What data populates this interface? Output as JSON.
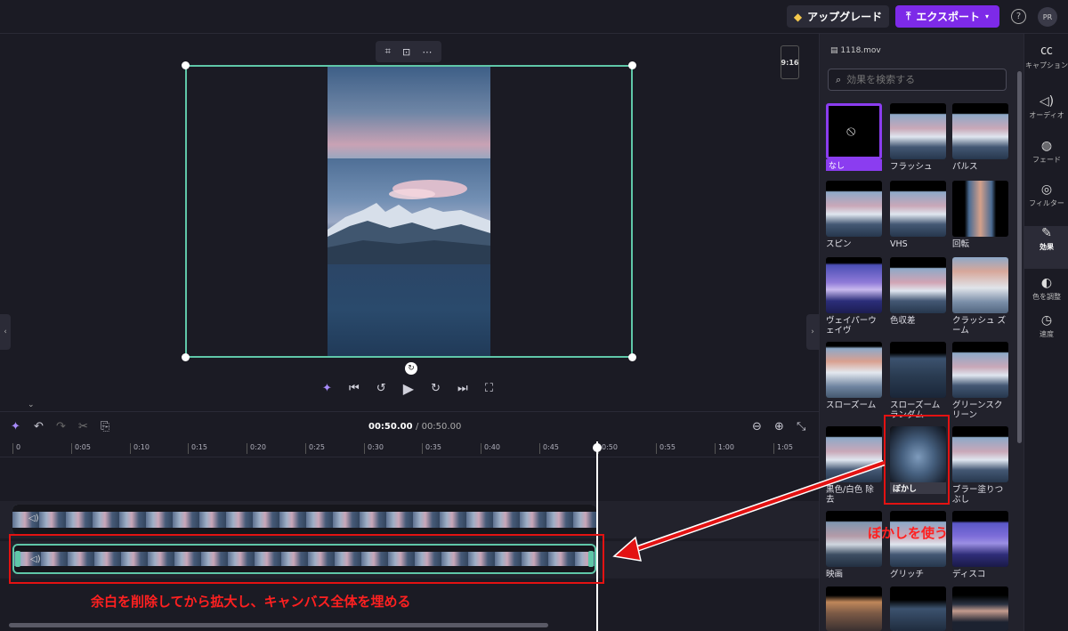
{
  "topbar": {
    "upgrade_label": "アップグレード",
    "export_label": "エクスポート",
    "help_label": "?",
    "avatar_initials": "PR"
  },
  "stage": {
    "ratio_label": "9:16",
    "context_toolbar": [
      "crop-icon",
      "fit-icon",
      "more-icon"
    ]
  },
  "timeline": {
    "current_time": "00:50.00",
    "total_time": "/ 00:50.00",
    "ruler_ticks": [
      "0",
      "0:05",
      "0:10",
      "0:15",
      "0:20",
      "0:25",
      "0:30",
      "0:35",
      "0:40",
      "0:45",
      "0:50",
      "0:55",
      "1:00",
      "1:05"
    ]
  },
  "panel": {
    "file_name": "1118.mov",
    "search_placeholder": "効果を検索する",
    "effects": [
      "なし",
      "フラッシュ",
      "パルス",
      "スピン",
      "VHS",
      "回転",
      "ヴェイパーウェイヴ",
      "色収差",
      "クラッシュ ズーム",
      "スローズーム",
      "スローズーム ランダム",
      "グリーンスクリーン",
      "黒色/白色 除去",
      "ぼかし",
      "ブラー塗りつぶし",
      "映画",
      "グリッチ",
      "ディスコ"
    ]
  },
  "rail": {
    "items": [
      {
        "label": "キャプション",
        "icon": "captions-icon"
      },
      {
        "label": "オーディオ",
        "icon": "audio-icon"
      },
      {
        "label": "フェード",
        "icon": "fade-icon"
      },
      {
        "label": "フィルター",
        "icon": "filter-icon"
      },
      {
        "label": "効果",
        "icon": "effects-icon"
      },
      {
        "label": "色を調整",
        "icon": "color-adjust-icon"
      },
      {
        "label": "速度",
        "icon": "speed-icon"
      }
    ]
  },
  "annotations": {
    "blur_note": "ぼかしを使う",
    "canvas_note": "余白を削除してから拡大し、キャンバス全体を埋める"
  },
  "colors": {
    "accent": "#7d2ae8",
    "selection": "#5fc7a8",
    "annotation_red": "#e31212"
  }
}
